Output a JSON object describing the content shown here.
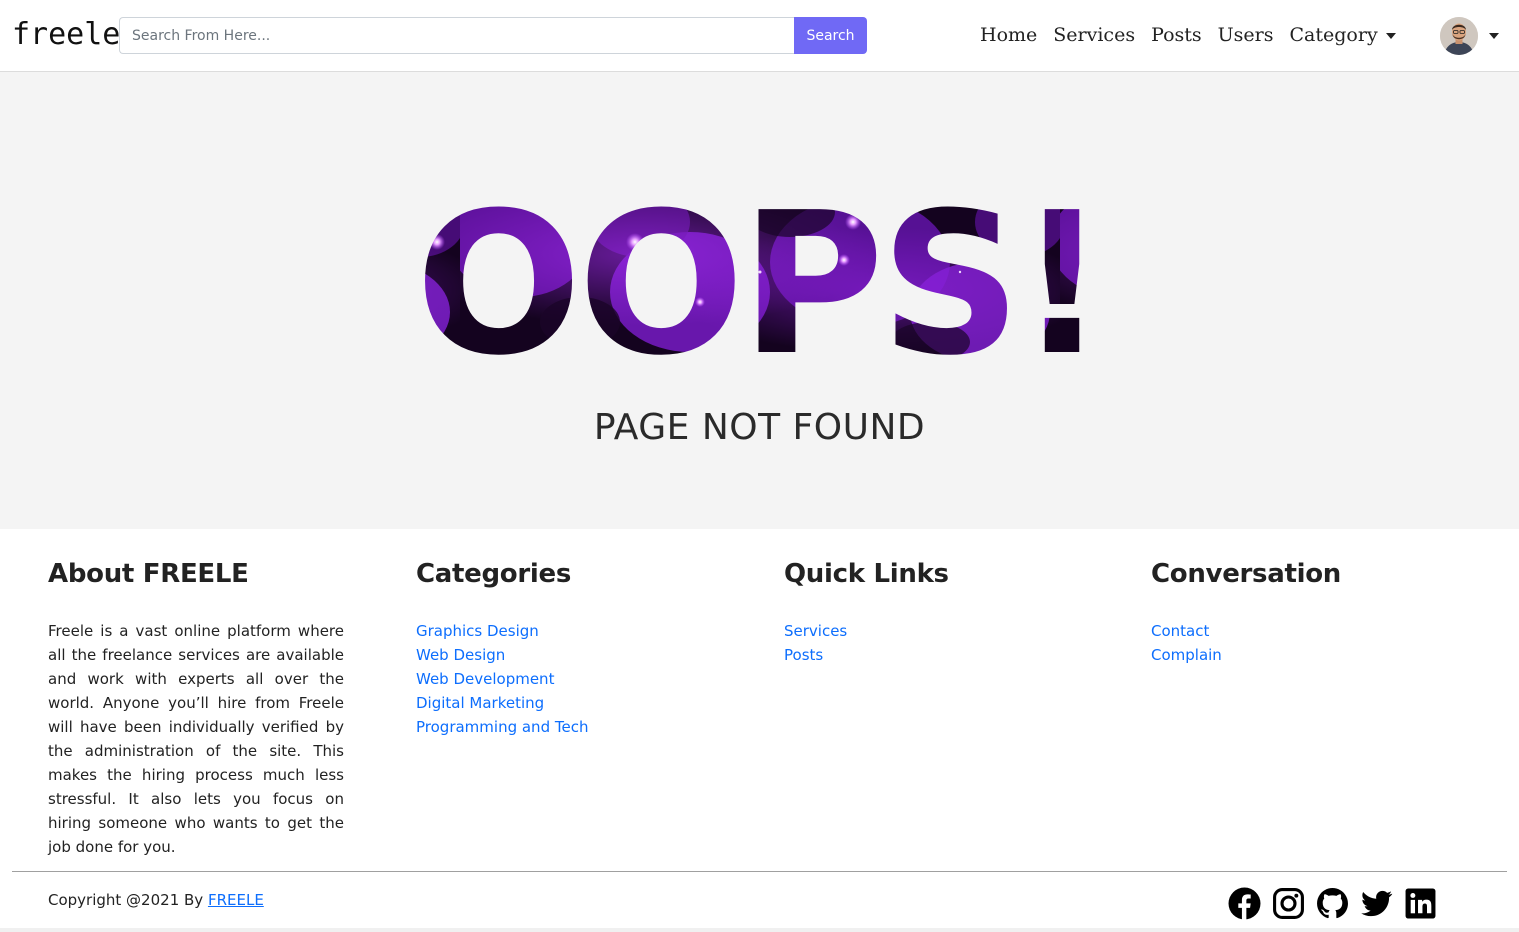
{
  "navbar": {
    "brand": "freele",
    "search": {
      "placeholder": "Search From Here...",
      "button_label": "Search"
    },
    "links": [
      {
        "label": "Home"
      },
      {
        "label": "Services"
      },
      {
        "label": "Posts"
      },
      {
        "label": "Users"
      },
      {
        "label": "Category",
        "dropdown": true
      }
    ],
    "avatar_icon": "user-avatar"
  },
  "hero": {
    "headline": "OOPS!",
    "subheadline": "PAGE NOT FOUND"
  },
  "footer": {
    "about": {
      "title": "About FREELE",
      "text": "Freele is a vast online platform where all the freelance services are available and work with experts all over the world. Anyone you’ll hire from Freele will have been individually verified by the administration of the site. This makes the hiring process much less stressful. It also lets you focus on hiring someone who wants to get the job done for you."
    },
    "categories": {
      "title": "Categories",
      "items": [
        "Graphics Design",
        "Web Design",
        "Web Development",
        "Digital Marketing",
        "Programming and Tech"
      ]
    },
    "quick_links": {
      "title": "Quick Links",
      "items": [
        "Services",
        "Posts"
      ]
    },
    "conversation": {
      "title": "Conversation",
      "items": [
        "Contact",
        "Complain"
      ]
    },
    "copyright_prefix": "Copyright @2021 By",
    "copyright_link": "FREELE",
    "socials": [
      "facebook-icon",
      "instagram-icon",
      "github-icon",
      "twitter-icon",
      "linkedin-icon"
    ]
  },
  "colors": {
    "accent": "#7069f5",
    "link": "#0d6efd",
    "hero_bg": "#f4f4f4",
    "galaxy_purple": "#7a18c8"
  }
}
